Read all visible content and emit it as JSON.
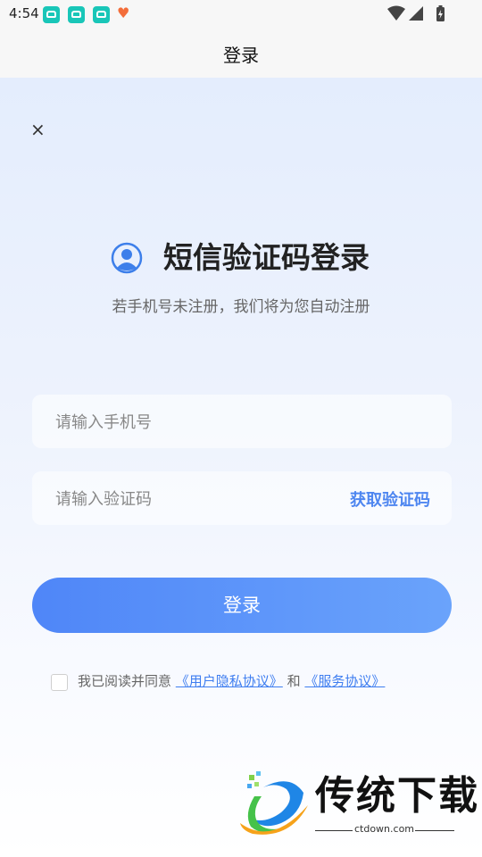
{
  "status": {
    "time": "4:54"
  },
  "header": {
    "title": "登录"
  },
  "page": {
    "close": "×",
    "title": "短信验证码登录",
    "subtitle": "若手机号未注册，我们将为您自动注册"
  },
  "form": {
    "phone_placeholder": "请输入手机号",
    "code_placeholder": "请输入验证码",
    "get_code": "获取验证码",
    "login_label": "登录"
  },
  "agreement": {
    "prefix": "我已阅读并同意",
    "privacy": "《用户隐私协议》",
    "and": "和",
    "service": "《服务协议》"
  },
  "watermark": {
    "brand": "传统下载",
    "url": "ctdown.com"
  },
  "colors": {
    "accent": "#4e86f0",
    "button_start": "#4f86f8",
    "button_end": "#6aa3fb"
  }
}
